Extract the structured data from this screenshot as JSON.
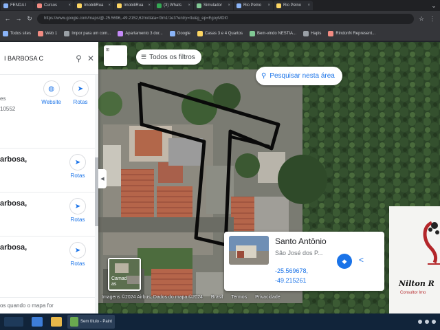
{
  "browser": {
    "tabs": [
      {
        "label": "FENDA I",
        "color": "#8ab4f8"
      },
      {
        "label": "Cursos",
        "color": "#f28b82"
      },
      {
        "label": "ImobiliRua",
        "color": "#fdd663"
      },
      {
        "label": "ImobiliRua",
        "color": "#fdd663"
      },
      {
        "label": "(3) Whats",
        "color": "#34a853"
      },
      {
        "label": "Simulador",
        "color": "#81c995"
      },
      {
        "label": "Rio Pelno",
        "color": "#8ab4f8"
      },
      {
        "label": "Rio Pelno",
        "color": "#fdd663"
      }
    ],
    "url": "https://www.google.com/maps/@-25.5696,-49.2152,62m/data=!3m1!1e3?entry=ttu&g_ep=EgoyMDI0",
    "bookmarks": [
      {
        "label": "Todos sites",
        "color": "#8ab4f8"
      },
      {
        "label": "Web 1",
        "color": "#f28b82"
      },
      {
        "label": "Impor para um com...",
        "color": "#9aa0a6"
      },
      {
        "label": "Apartamento 3 dor...",
        "color": "#c58af9"
      },
      {
        "label": "Google",
        "color": "#8ab4f8"
      },
      {
        "label": "Casas 3 e 4 Quartos",
        "color": "#fdd663"
      },
      {
        "label": "Bem-vindo NESTIA...",
        "color": "#81c995"
      },
      {
        "label": "Hapis",
        "color": "#9aa0a6"
      },
      {
        "label": "RindonN Represent...",
        "color": "#f28b82"
      }
    ]
  },
  "map": {
    "layers_label": "",
    "filters_label": "Todos os filtros",
    "search_area_label": "Pesquisar nesta área"
  },
  "sidebar": {
    "query": "I BARBOSA C",
    "website_label": "Website",
    "rotas_label": "Rotas",
    "fragment_1": "es",
    "fragment_2": "10552",
    "results": [
      {
        "name": "arbosa,",
        "rotas_label": "Rotas"
      },
      {
        "name": "arbosa,",
        "rotas_label": "Rotas"
      },
      {
        "name": "arbosa,",
        "rotas_label": "Rotas"
      }
    ],
    "footer": "os quando o mapa for"
  },
  "place_card": {
    "title": "Santo Antônio",
    "subtitle": "São José dos P...",
    "lat": "-25.569678,",
    "lng": "-49.215261"
  },
  "layer_thumb": {
    "label_1": "Camad",
    "label_2": "as"
  },
  "attribution": {
    "imagery": "Imagens ©2024 Airbus, Dados do mapa ©2024",
    "country": "Brasil",
    "terms": "Termos",
    "privacy": "Privacidade"
  },
  "logo": {
    "name": "Nilton R",
    "role": "Consultor Imo"
  },
  "taskbar": {
    "items": [
      {
        "label": "",
        "color": "#1e3a5a"
      },
      {
        "label": "",
        "color": "#3d7dd8"
      },
      {
        "label": "",
        "color": "#e8b84a"
      },
      {
        "label": "Sem título - Paint",
        "color": "#6aa84f"
      }
    ]
  }
}
